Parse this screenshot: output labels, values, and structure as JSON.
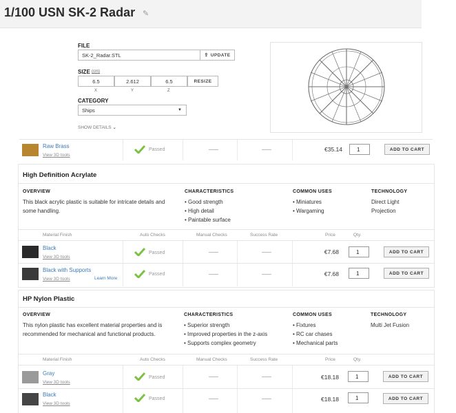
{
  "header": {
    "title": "1/100 USN SK-2 Radar",
    "edit_icon": "pencil-icon"
  },
  "file_panel": {
    "file_label": "FILE",
    "file_name": "SK-2_Radar.STL",
    "update_label": "UPDATE",
    "size_label": "SIZE",
    "size_unit": "(cm)",
    "size_x": "6.5",
    "size_y": "2.612",
    "size_z": "6.5",
    "axis_x": "X",
    "axis_y": "Y",
    "axis_z": "Z",
    "resize_label": "RESIZE",
    "category_label": "CATEGORY",
    "category_value": "Ships",
    "show_details": "SHOW DETAILS"
  },
  "raw_brass": {
    "name": "Raw Brass",
    "tools": "View 3D tools",
    "status": "Passed",
    "price": "€35.14",
    "qty": "1",
    "cart": "ADD TO CART",
    "swatch": "#b8862e"
  },
  "materials": [
    {
      "title": "High Definition Acrylate",
      "overview_h": "OVERVIEW",
      "overview": "This black acrylic plastic is suitable for intricate details and some handling.",
      "char_h": "CHARACTERISTICS",
      "chars": [
        "• Good strength",
        "• High detail",
        "• Paintable surface"
      ],
      "uses_h": "COMMON USES",
      "uses": [
        "• Miniatures",
        "• Wargaming"
      ],
      "tech_h": "TECHNOLOGY",
      "tech": "Direct Light Projection",
      "table_headers": {
        "finish": "Material Finish",
        "auto": "Auto Checks",
        "manual": "Manual Checks",
        "success": "Success Rate",
        "price": "Price",
        "qty": "Qty."
      },
      "rows": [
        {
          "name": "Black",
          "tools": "View 3D tools",
          "extra": "",
          "status": "Passed",
          "price": "€7.68",
          "qty": "1",
          "cart": "ADD TO CART",
          "swatch": "#2a2a2a"
        },
        {
          "name": "Black with Supports",
          "tools": "View 3D tools",
          "extra": "Learn More",
          "status": "Passed",
          "price": "€7.68",
          "qty": "1",
          "cart": "ADD TO CART",
          "swatch": "#3a3a3a"
        }
      ]
    },
    {
      "title": "HP Nylon Plastic",
      "overview_h": "OVERVIEW",
      "overview": "This nylon plastic has excellent material properties and is recommended for mechanical and functional products.",
      "char_h": "CHARACTERISTICS",
      "chars": [
        "• Superior strength",
        "• Improved properties in the z-axis",
        "• Supports complex geometry"
      ],
      "uses_h": "COMMON USES",
      "uses": [
        "• Fixtures",
        "• RC car chases",
        "• Mechanical parts"
      ],
      "tech_h": "TECHNOLOGY",
      "tech": "Multi Jet Fusion",
      "table_headers": {
        "finish": "Material Finish",
        "auto": "Auto Checks",
        "manual": "Manual Checks",
        "success": "Success Rate",
        "price": "Price",
        "qty": "Qty."
      },
      "rows": [
        {
          "name": "Gray",
          "tools": "View 3D tools",
          "extra": "",
          "status": "Passed",
          "price": "€18.18",
          "qty": "1",
          "cart": "ADD TO CART",
          "swatch": "#9a9a9a"
        },
        {
          "name": "Black",
          "tools": "View 3D tools",
          "extra": "",
          "status": "Passed",
          "price": "€18.18",
          "qty": "1",
          "cart": "ADD TO CART",
          "swatch": "#454545"
        }
      ]
    }
  ],
  "colors": {
    "link": "#3d7ab8",
    "check": "#7cc242"
  }
}
